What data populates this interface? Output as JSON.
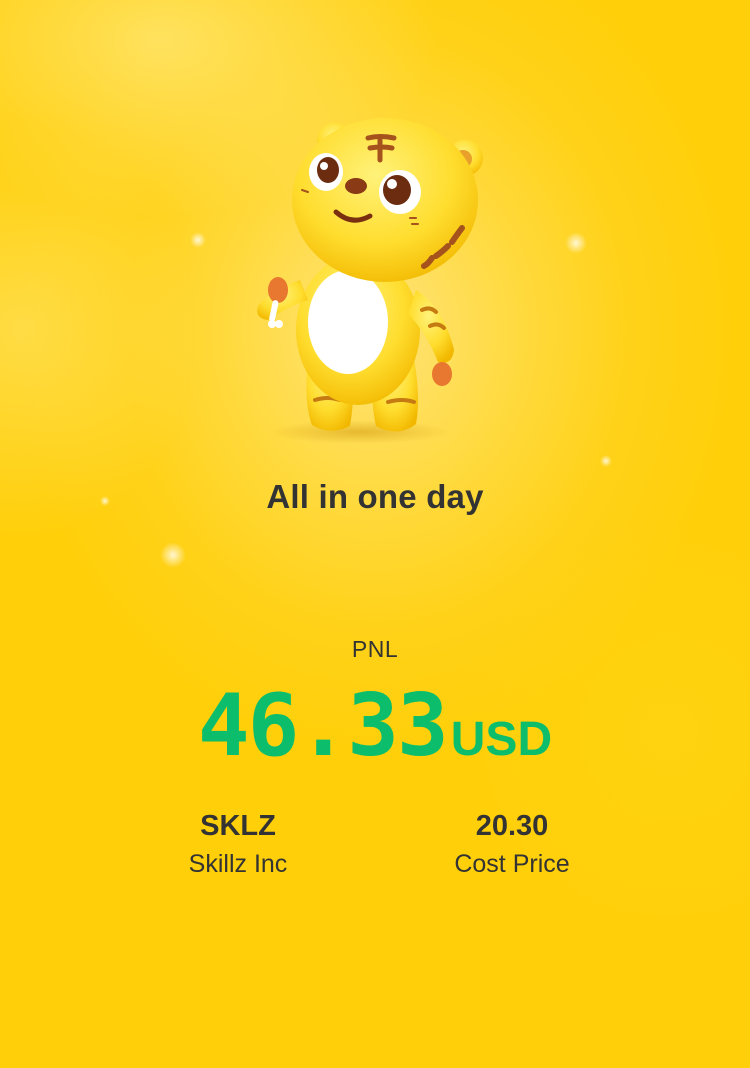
{
  "card": {
    "title": "All in one day",
    "background_color": "#FFD21A"
  },
  "pnl": {
    "label": "PNL",
    "value": "46.33",
    "unit": "USD",
    "color": "#0CBE6C"
  },
  "stock": {
    "ticker": "SKLZ",
    "name": "Skillz Inc"
  },
  "cost": {
    "value": "20.30",
    "label": "Cost Price"
  },
  "mascot": {
    "icon": "tiger-mascot-icon"
  }
}
